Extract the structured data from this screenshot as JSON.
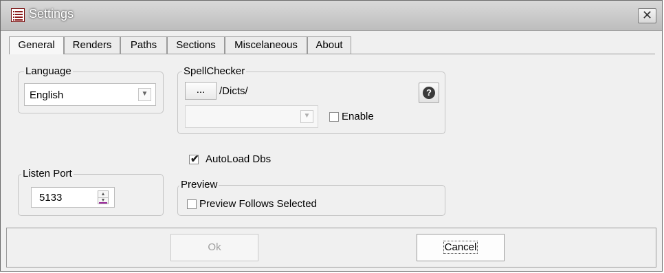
{
  "window": {
    "title": "Settings",
    "close_glyph": "✕",
    "app_icon": "list-icon"
  },
  "tabs": [
    {
      "label": "General"
    },
    {
      "label": "Renders"
    },
    {
      "label": "Paths"
    },
    {
      "label": "Sections"
    },
    {
      "label": "Miscelaneous"
    },
    {
      "label": "About"
    }
  ],
  "language": {
    "group_label": "Language",
    "selected": "English"
  },
  "spellchecker": {
    "group_label": "SpellChecker",
    "browse_label": "...",
    "path": "/Dicts/",
    "help_glyph": "?",
    "dict_selected": "",
    "enable_label": "Enable",
    "enabled": false
  },
  "autoload": {
    "label": "AutoLoad Dbs",
    "checked": true,
    "mark": "✔"
  },
  "listen_port": {
    "group_label": "Listen Port",
    "value": "5133"
  },
  "preview": {
    "group_label": "Preview",
    "follows_label": "Preview Follows Selected",
    "checked": false
  },
  "buttons": {
    "ok_label": "Ok",
    "cancel_label": "Cancel"
  },
  "colors": {
    "title_bar": "#c8c8c8",
    "background": "#f0f0f0",
    "app_icon": "#8b1a1a",
    "spin_accent": "#9d2d9d"
  }
}
